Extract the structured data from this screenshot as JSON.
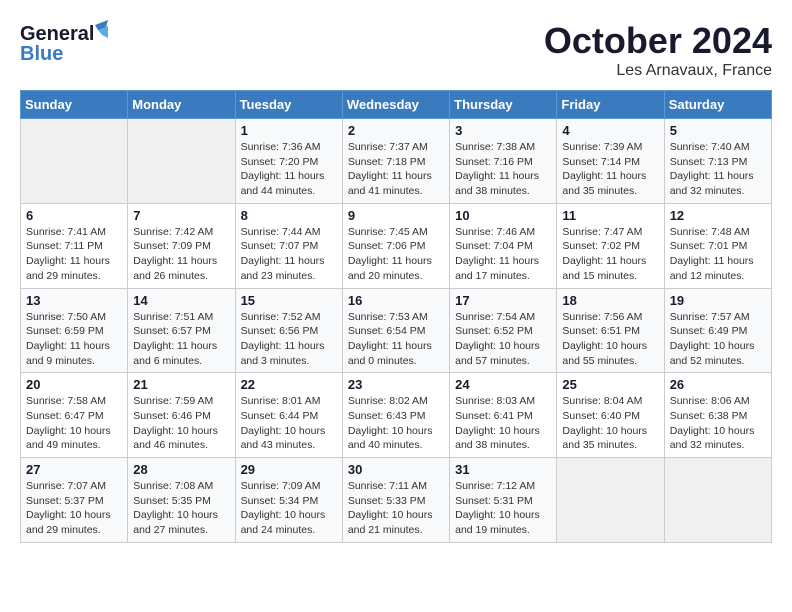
{
  "header": {
    "logo_general": "General",
    "logo_blue": "Blue",
    "month_title": "October 2024",
    "location": "Les Arnavaux, France"
  },
  "days_of_week": [
    "Sunday",
    "Monday",
    "Tuesday",
    "Wednesday",
    "Thursday",
    "Friday",
    "Saturday"
  ],
  "weeks": [
    {
      "cells": [
        {
          "day": "",
          "info": ""
        },
        {
          "day": "",
          "info": ""
        },
        {
          "day": "1",
          "info": "Sunrise: 7:36 AM\nSunset: 7:20 PM\nDaylight: 11 hours and 44 minutes."
        },
        {
          "day": "2",
          "info": "Sunrise: 7:37 AM\nSunset: 7:18 PM\nDaylight: 11 hours and 41 minutes."
        },
        {
          "day": "3",
          "info": "Sunrise: 7:38 AM\nSunset: 7:16 PM\nDaylight: 11 hours and 38 minutes."
        },
        {
          "day": "4",
          "info": "Sunrise: 7:39 AM\nSunset: 7:14 PM\nDaylight: 11 hours and 35 minutes."
        },
        {
          "day": "5",
          "info": "Sunrise: 7:40 AM\nSunset: 7:13 PM\nDaylight: 11 hours and 32 minutes."
        }
      ]
    },
    {
      "cells": [
        {
          "day": "6",
          "info": "Sunrise: 7:41 AM\nSunset: 7:11 PM\nDaylight: 11 hours and 29 minutes."
        },
        {
          "day": "7",
          "info": "Sunrise: 7:42 AM\nSunset: 7:09 PM\nDaylight: 11 hours and 26 minutes."
        },
        {
          "day": "8",
          "info": "Sunrise: 7:44 AM\nSunset: 7:07 PM\nDaylight: 11 hours and 23 minutes."
        },
        {
          "day": "9",
          "info": "Sunrise: 7:45 AM\nSunset: 7:06 PM\nDaylight: 11 hours and 20 minutes."
        },
        {
          "day": "10",
          "info": "Sunrise: 7:46 AM\nSunset: 7:04 PM\nDaylight: 11 hours and 17 minutes."
        },
        {
          "day": "11",
          "info": "Sunrise: 7:47 AM\nSunset: 7:02 PM\nDaylight: 11 hours and 15 minutes."
        },
        {
          "day": "12",
          "info": "Sunrise: 7:48 AM\nSunset: 7:01 PM\nDaylight: 11 hours and 12 minutes."
        }
      ]
    },
    {
      "cells": [
        {
          "day": "13",
          "info": "Sunrise: 7:50 AM\nSunset: 6:59 PM\nDaylight: 11 hours and 9 minutes."
        },
        {
          "day": "14",
          "info": "Sunrise: 7:51 AM\nSunset: 6:57 PM\nDaylight: 11 hours and 6 minutes."
        },
        {
          "day": "15",
          "info": "Sunrise: 7:52 AM\nSunset: 6:56 PM\nDaylight: 11 hours and 3 minutes."
        },
        {
          "day": "16",
          "info": "Sunrise: 7:53 AM\nSunset: 6:54 PM\nDaylight: 11 hours and 0 minutes."
        },
        {
          "day": "17",
          "info": "Sunrise: 7:54 AM\nSunset: 6:52 PM\nDaylight: 10 hours and 57 minutes."
        },
        {
          "day": "18",
          "info": "Sunrise: 7:56 AM\nSunset: 6:51 PM\nDaylight: 10 hours and 55 minutes."
        },
        {
          "day": "19",
          "info": "Sunrise: 7:57 AM\nSunset: 6:49 PM\nDaylight: 10 hours and 52 minutes."
        }
      ]
    },
    {
      "cells": [
        {
          "day": "20",
          "info": "Sunrise: 7:58 AM\nSunset: 6:47 PM\nDaylight: 10 hours and 49 minutes."
        },
        {
          "day": "21",
          "info": "Sunrise: 7:59 AM\nSunset: 6:46 PM\nDaylight: 10 hours and 46 minutes."
        },
        {
          "day": "22",
          "info": "Sunrise: 8:01 AM\nSunset: 6:44 PM\nDaylight: 10 hours and 43 minutes."
        },
        {
          "day": "23",
          "info": "Sunrise: 8:02 AM\nSunset: 6:43 PM\nDaylight: 10 hours and 40 minutes."
        },
        {
          "day": "24",
          "info": "Sunrise: 8:03 AM\nSunset: 6:41 PM\nDaylight: 10 hours and 38 minutes."
        },
        {
          "day": "25",
          "info": "Sunrise: 8:04 AM\nSunset: 6:40 PM\nDaylight: 10 hours and 35 minutes."
        },
        {
          "day": "26",
          "info": "Sunrise: 8:06 AM\nSunset: 6:38 PM\nDaylight: 10 hours and 32 minutes."
        }
      ]
    },
    {
      "cells": [
        {
          "day": "27",
          "info": "Sunrise: 7:07 AM\nSunset: 5:37 PM\nDaylight: 10 hours and 29 minutes."
        },
        {
          "day": "28",
          "info": "Sunrise: 7:08 AM\nSunset: 5:35 PM\nDaylight: 10 hours and 27 minutes."
        },
        {
          "day": "29",
          "info": "Sunrise: 7:09 AM\nSunset: 5:34 PM\nDaylight: 10 hours and 24 minutes."
        },
        {
          "day": "30",
          "info": "Sunrise: 7:11 AM\nSunset: 5:33 PM\nDaylight: 10 hours and 21 minutes."
        },
        {
          "day": "31",
          "info": "Sunrise: 7:12 AM\nSunset: 5:31 PM\nDaylight: 10 hours and 19 minutes."
        },
        {
          "day": "",
          "info": ""
        },
        {
          "day": "",
          "info": ""
        }
      ]
    }
  ]
}
